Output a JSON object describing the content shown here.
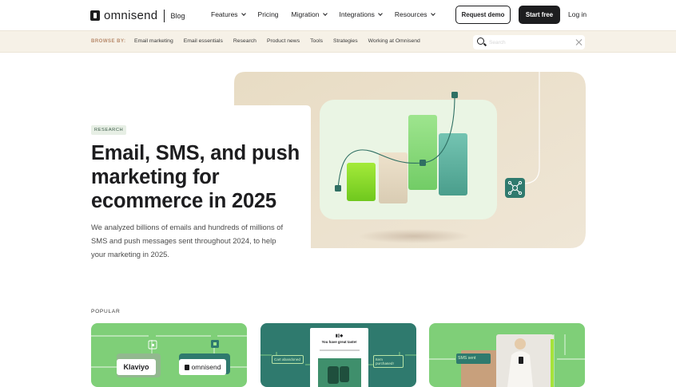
{
  "header": {
    "brand": "omnisend",
    "section": "Blog",
    "nav": [
      {
        "label": "Features",
        "dropdown": true
      },
      {
        "label": "Pricing",
        "dropdown": false
      },
      {
        "label": "Migration",
        "dropdown": true
      },
      {
        "label": "Integrations",
        "dropdown": true
      },
      {
        "label": "Resources",
        "dropdown": true
      }
    ],
    "request_demo": "Request demo",
    "start_free": "Start free",
    "login": "Log in"
  },
  "browse": {
    "label": "BROWSE BY:",
    "links": [
      "Email marketing",
      "Email essentials",
      "Research",
      "Product news",
      "Tools",
      "Strategies",
      "Working at Omnisend"
    ],
    "search_placeholder": "Search"
  },
  "hero": {
    "tag": "RESEARCH",
    "title": "Email, SMS, and push marketing for ecommerce in 2025",
    "description": "We analyzed billions of emails and hundreds of millions of SMS and push messages sent throughout 2024, to help your marketing in 2025."
  },
  "popular": {
    "label": "POPULAR",
    "cards": [
      {
        "badge_left": "Klaviyo",
        "badge_right": "omnisend"
      },
      {
        "notice_title": "You have great taste!",
        "label_left": "Cart abandoned",
        "label_right": "Item purchased!"
      },
      {
        "chip": "SMS sent"
      }
    ]
  },
  "colors": {
    "dark": "#1d1d1f",
    "beige": "#f6f1e7",
    "green": "#7fcf78",
    "teal": "#2f7a6e"
  }
}
